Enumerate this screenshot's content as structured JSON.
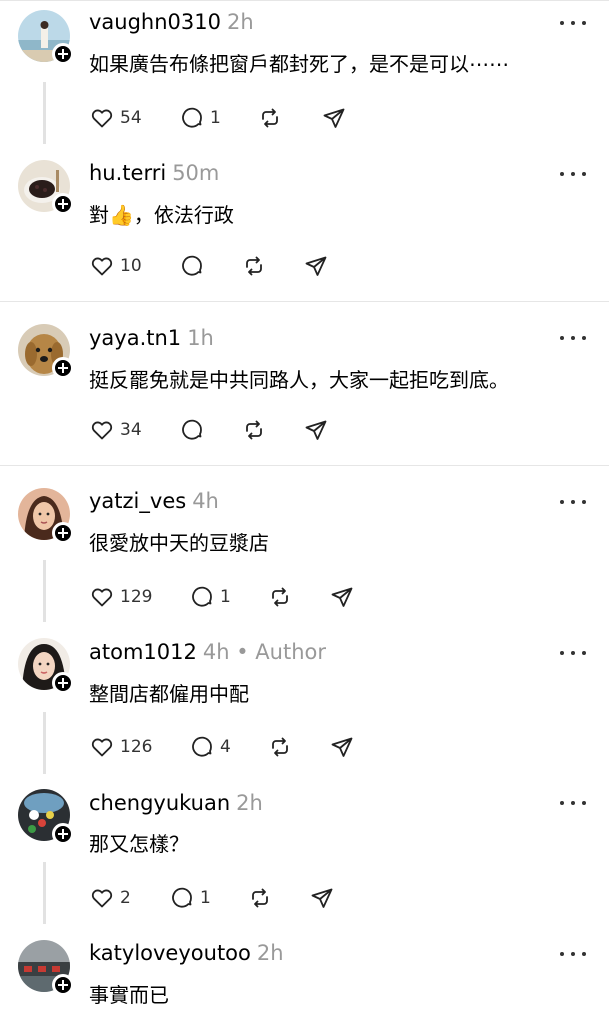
{
  "posts": [
    {
      "username": "vaughn0310",
      "time": "2h",
      "author_tag": "",
      "text": "如果廣告布條把窗戶都封死了，是不是可以⋯⋯",
      "likes": "54",
      "replies": "1"
    },
    {
      "username": "hu.terri",
      "time": "50m",
      "author_tag": "",
      "text_before": "對",
      "emoji": "👍",
      "text_after": "，依法行政",
      "likes": "10",
      "replies": ""
    },
    {
      "username": "yaya.tn1",
      "time": "1h",
      "author_tag": "",
      "text": "挺反罷免就是中共同路人，大家一起拒吃到底。",
      "likes": "34",
      "replies": ""
    },
    {
      "username": "yatzi_ves",
      "time": "4h",
      "author_tag": "",
      "text": "很愛放中天的豆漿店",
      "likes": "129",
      "replies": "1"
    },
    {
      "username": "atom1012",
      "time": "4h",
      "author_tag": "• Author",
      "text": "整間店都僱用中配",
      "likes": "126",
      "replies": "4"
    },
    {
      "username": "chengyukuan",
      "time": "2h",
      "author_tag": "",
      "text": "那又怎樣？",
      "likes": "2",
      "replies": "1"
    },
    {
      "username": "katyloveyoutoo",
      "time": "2h",
      "author_tag": "",
      "text": "事實而已",
      "likes": "",
      "replies": ""
    }
  ],
  "icons": {
    "like": "heart-icon",
    "reply": "speech-bubble-icon",
    "repost": "repost-icon",
    "share": "paper-plane-icon",
    "more": "more-dots-icon",
    "follow": "plus-icon"
  }
}
